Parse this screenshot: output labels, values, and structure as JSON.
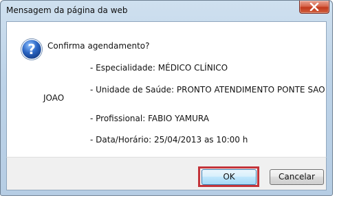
{
  "dialog": {
    "title": "Mensagem da página da web",
    "question": "Confirma agendamento?",
    "lines": {
      "especialidade": "- Especialidade: MÉDICO CLÍNICO",
      "unidade": "- Unidade de Saúde: PRONTO ATENDIMENTO PONTE SAO",
      "unidade_cont": "JOAO",
      "profissional": "- Profissional: FABIO YAMURA",
      "data_horario": "- Data/Horário: 25/04/2013 as 10:00 h"
    },
    "buttons": {
      "ok_label": "OK",
      "cancel_label": "Cancelar"
    },
    "icons": {
      "close": "close-icon",
      "question": "question-icon"
    },
    "colors": {
      "highlight_box": "#c3343a",
      "question_icon": "#2b66c4",
      "close_button": "#c1391c"
    }
  }
}
